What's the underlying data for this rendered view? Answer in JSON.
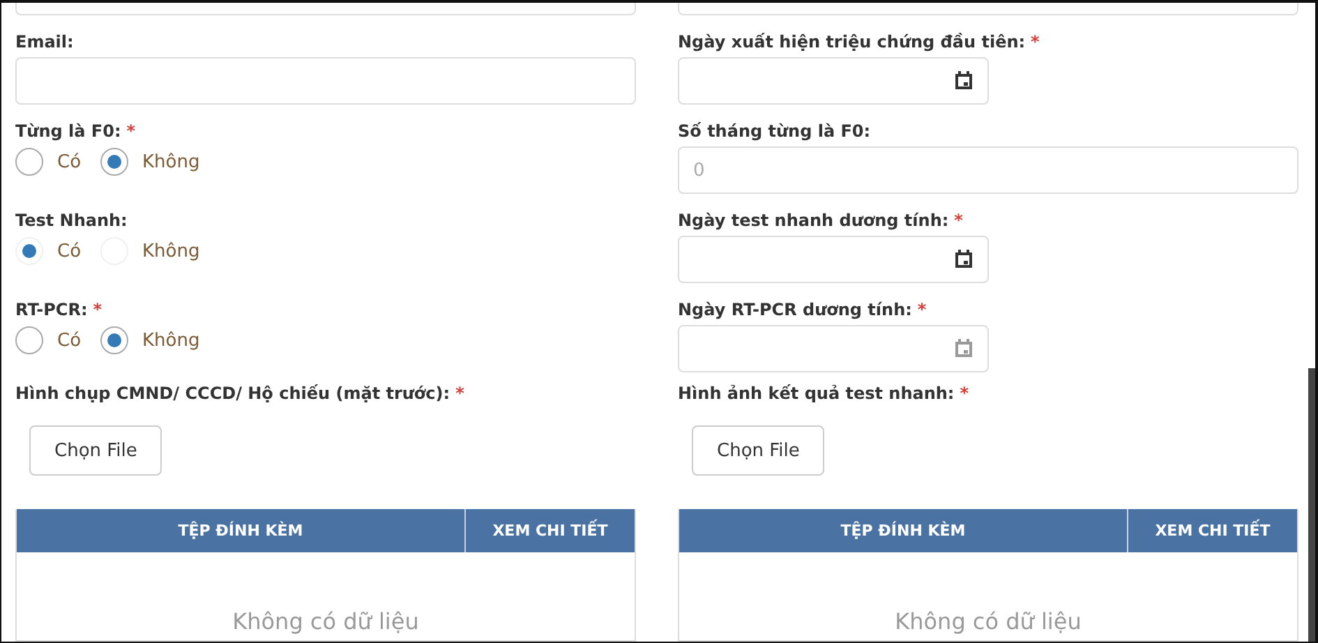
{
  "columns": [
    {
      "fields": [
        {
          "kind": "text",
          "label": "Email:"
        },
        {
          "kind": "radio",
          "label": "Từng là F0:",
          "required_mark": "*",
          "disabled": false,
          "options": [
            {
              "label": "Có",
              "selected": false
            },
            {
              "label": "Không",
              "selected": true
            }
          ]
        },
        {
          "kind": "radio",
          "label": "Test Nhanh:",
          "disabled": true,
          "options": [
            {
              "label": "Có",
              "selected": true
            },
            {
              "label": "Không",
              "selected": false
            }
          ]
        },
        {
          "kind": "radio",
          "label": "RT-PCR:",
          "required_mark": "*",
          "disabled": false,
          "options": [
            {
              "label": "Có",
              "selected": false
            },
            {
              "label": "Không",
              "selected": true
            }
          ]
        }
      ],
      "upload": {
        "label": "Hình chụp CMND/ CCCD/ Hộ chiếu (mặt trước):",
        "required_mark": "*",
        "button": "Chọn File"
      },
      "table": {
        "columns": [
          "TỆP ĐÍNH KÈM",
          "XEM CHI TIẾT"
        ],
        "empty_message": "Không có dữ liệu"
      }
    },
    {
      "fields": [
        {
          "kind": "date",
          "label": "Ngày xuất hiện triệu chứng đầu tiên:",
          "required_mark": "*",
          "disabled": false
        },
        {
          "kind": "number",
          "label": "Số tháng từng là F0:",
          "placeholder": "0"
        },
        {
          "kind": "date",
          "label": "Ngày test nhanh dương tính:",
          "required_mark": "*",
          "disabled": false
        },
        {
          "kind": "date",
          "label": "Ngày RT-PCR dương tính:",
          "required_mark": "*",
          "disabled": true
        }
      ],
      "upload": {
        "label": "Hình ảnh kết quả test nhanh:",
        "required_mark": "*",
        "button": "Chọn File"
      },
      "table": {
        "columns": [
          "TỆP ĐÍNH KÈM",
          "XEM CHI TIẾT"
        ],
        "empty_message": "Không có dữ liệu"
      }
    }
  ]
}
